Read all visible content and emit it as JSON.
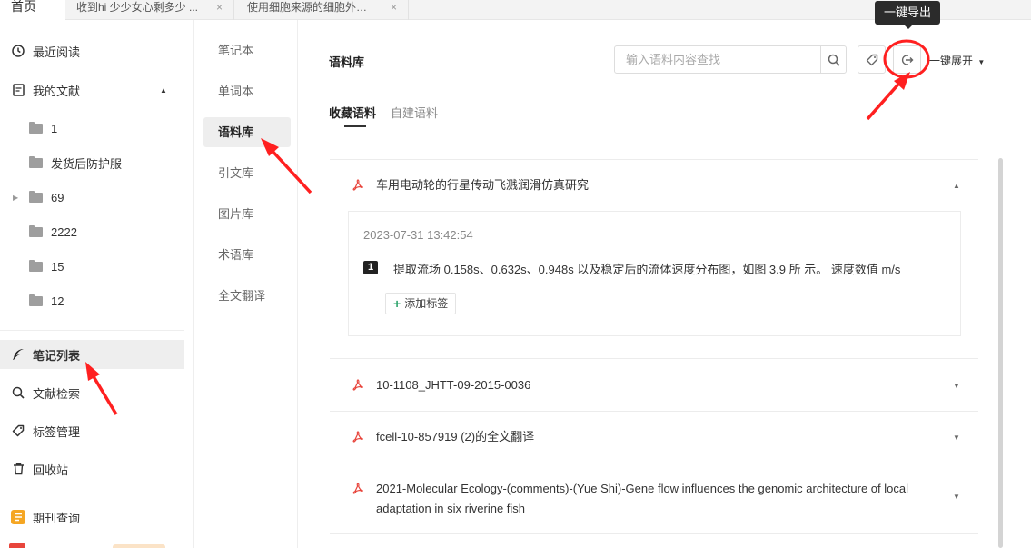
{
  "tabs": [
    {
      "label": "首页"
    },
    {
      "label": "收到hi 少少女心剩多少 ..."
    },
    {
      "label": "使用细胞来源的细胞外基..."
    }
  ],
  "tab_close_glyph": "×",
  "sidebar": {
    "recent": "最近阅读",
    "my_docs": "我的文献",
    "folders": [
      {
        "name": "1"
      },
      {
        "name": "发货后防护服"
      },
      {
        "name": "69"
      },
      {
        "name": "2222"
      },
      {
        "name": "15"
      },
      {
        "name": "12"
      }
    ],
    "notes_list": "笔记列表",
    "doc_search": "文献检索",
    "tag_manage": "标签管理",
    "recycle": "回收站",
    "journal": "期刊查询"
  },
  "notes_nav": [
    "笔记本",
    "单词本",
    "语料库",
    "引文库",
    "图片库",
    "术语库",
    "全文翻译"
  ],
  "main": {
    "title": "语料库",
    "search_placeholder": "输入语料内容查找",
    "expand_all": "一键展开",
    "export_tooltip": "一键导出",
    "subtabs": [
      "收藏语料",
      "自建语料"
    ]
  },
  "corpus": [
    {
      "title": "车用电动轮的行星传动飞溅润滑仿真研究",
      "expanded": true,
      "timestamp": "2023-07-31 13:42:54",
      "index": "1",
      "content": "提取流场 0.158s、0.632s、0.948s 以及稳定后的流体速度分布图，如图 3.9 所 示。 速度数值 m/s",
      "add_tag": "添加标签"
    },
    {
      "title": "10-1108_JHTT-09-2015-0036",
      "expanded": false
    },
    {
      "title": "fcell-10-857919 (2)的全文翻译",
      "expanded": false
    },
    {
      "title": "2021-Molecular Ecology-(comments)-(Yue Shi)-Gene flow influences the genomic architecture of local adaptation in six riverine fish",
      "expanded": false
    }
  ],
  "colors": {
    "accent_red": "#ff2020",
    "pdf_red": "#e8453c",
    "journal_orange": "#f5a623"
  }
}
